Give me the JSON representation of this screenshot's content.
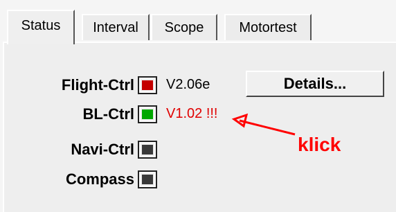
{
  "tabs": [
    {
      "label": "Status",
      "active": true
    },
    {
      "label": "Interval",
      "active": false
    },
    {
      "label": "Scope",
      "active": false
    },
    {
      "label": "Motortest",
      "active": false
    }
  ],
  "status": {
    "rows": [
      {
        "label": "Flight-Ctrl",
        "led_color": "#c40000",
        "version": "V2.06e",
        "version_color": "#000000"
      },
      {
        "label": "BL-Ctrl",
        "led_color": "#00a800",
        "version": "V1.02 !!!",
        "version_color": "#e00000"
      },
      {
        "label": "Navi-Ctrl",
        "led_color": "#3a3a3a",
        "version": ""
      },
      {
        "label": "Compass",
        "led_color": "#3a3a3a",
        "version": ""
      }
    ],
    "details_button": "Details...",
    "annotation": "klick",
    "annotation_color": "#ff0000"
  }
}
